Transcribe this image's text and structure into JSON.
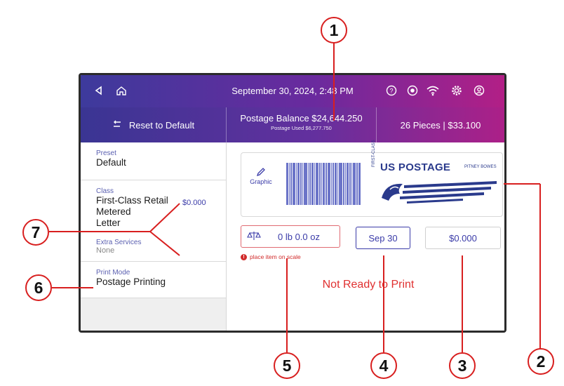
{
  "status_bar": {
    "datetime": "September 30, 2024, 2:48 PM",
    "icons": [
      "back-icon",
      "home-icon",
      "help-icon",
      "record-icon",
      "wifi-icon",
      "gear-icon",
      "user-icon"
    ]
  },
  "toolbar": {
    "reset_label": "Reset to Default",
    "balance_label": "Postage Balance $24,644.250",
    "used_label": "Postage Used $6,277.750",
    "pieces_label": "26 Pieces | $33.100"
  },
  "left_panel": {
    "preset": {
      "label": "Preset",
      "value": "Default"
    },
    "class": {
      "label": "Class",
      "value_lines": [
        "First-Class Retail",
        "Metered",
        "Letter"
      ],
      "price": "$0.000"
    },
    "extra_services": {
      "label": "Extra Services",
      "value": "None"
    },
    "print_mode": {
      "label": "Print Mode",
      "value": "Postage Printing"
    }
  },
  "stamp": {
    "graphic_label": "Graphic",
    "postage_label": "US POSTAGE",
    "pb_label": "PITNEY BOWES",
    "class_label": "FIRST-CLASS"
  },
  "weight": {
    "value": "0 lb 0.0 oz"
  },
  "warning": {
    "text": "place item on scale"
  },
  "date_button": {
    "label": "Sep 30"
  },
  "amount_button": {
    "label": "$0.000"
  },
  "status_message": "Not Ready to Print",
  "callouts": [
    "1",
    "2",
    "3",
    "4",
    "5",
    "6",
    "7"
  ],
  "colors": {
    "accent": "#3a3ba8",
    "callout": "#d81f1f",
    "warning": "#d12b2b"
  }
}
